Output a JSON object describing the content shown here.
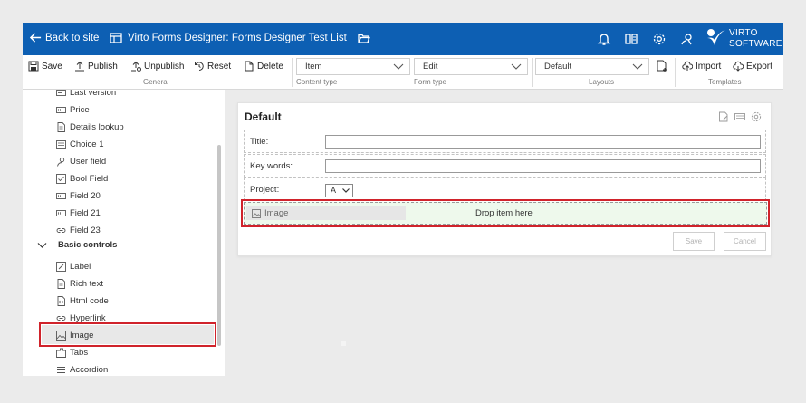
{
  "topbar": {
    "back_label": "Back to site",
    "title": "Virto Forms Designer: Forms Designer Test List",
    "logo_line1": "VIRTO",
    "logo_line2": "SOFTWARE"
  },
  "ribbon": {
    "general": {
      "save": "Save",
      "publish": "Publish",
      "unpublish": "Unpublish",
      "reset": "Reset",
      "delete": "Delete",
      "group_label": "General"
    },
    "content_type": {
      "value": "Item",
      "label": "Content type"
    },
    "form_type": {
      "value": "Edit",
      "label": "Form type"
    },
    "layouts": {
      "value": "Default",
      "label": "Layouts"
    },
    "templates": {
      "import": "Import",
      "export": "Export",
      "label": "Templates"
    }
  },
  "sidebar": {
    "items": [
      {
        "label": "Last version",
        "icon": "text-field-icon"
      },
      {
        "label": "Price",
        "icon": "number-field-icon"
      },
      {
        "label": "Details lookup",
        "icon": "document-icon"
      },
      {
        "label": "Choice 1",
        "icon": "choice-icon"
      },
      {
        "label": "User field",
        "icon": "user-icon"
      },
      {
        "label": "Bool Field",
        "icon": "checkbox-icon"
      },
      {
        "label": "Field 20",
        "icon": "number-field-icon"
      },
      {
        "label": "Field 21",
        "icon": "number-field-icon"
      },
      {
        "label": "Field 23",
        "icon": "link-icon"
      }
    ],
    "group": {
      "label": "Basic controls"
    },
    "controls": [
      {
        "label": "Label",
        "icon": "label-icon"
      },
      {
        "label": "Rich text",
        "icon": "document-icon"
      },
      {
        "label": "Html code",
        "icon": "code-icon"
      },
      {
        "label": "Hyperlink",
        "icon": "link-icon"
      },
      {
        "label": "Image",
        "icon": "image-icon"
      },
      {
        "label": "Tabs",
        "icon": "tabs-icon"
      },
      {
        "label": "Accordion",
        "icon": "accordion-icon"
      }
    ]
  },
  "form": {
    "title": "Default",
    "rows": [
      {
        "label": "Title:"
      },
      {
        "label": "Key words:"
      },
      {
        "label": "Project:",
        "select_value": "A"
      }
    ],
    "drop_zone": {
      "chip_label": "Image",
      "text": "Drop item here"
    },
    "save_button": "Save",
    "cancel_button": "Cancel"
  },
  "colors": {
    "brand_blue": "#0d5fb3",
    "highlight_red": "#d0232b",
    "drop_green": "#eef9ec"
  }
}
